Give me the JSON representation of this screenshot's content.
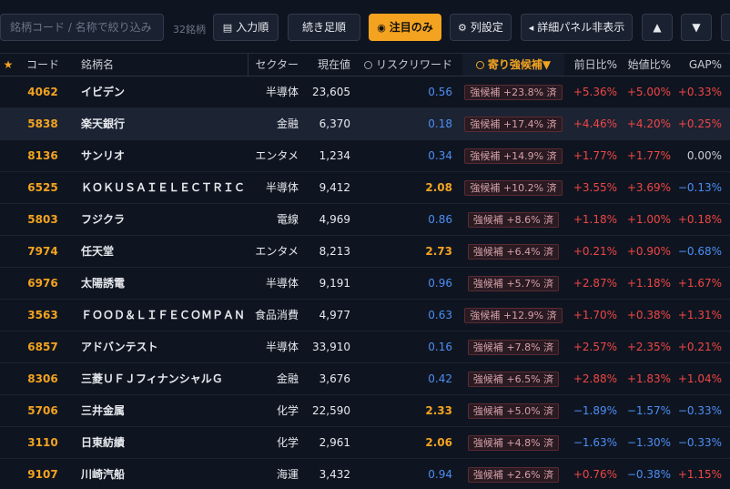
{
  "toolbar": {
    "search_placeholder": "銘柄コード / 名称で絞り込み",
    "count": "32銘柄",
    "btn_order": "入力順",
    "btn_daily": "続き足順",
    "btn_focus": "注目のみ",
    "btn_cols": "列設定",
    "btn_panel": "詳細パネル非表示",
    "btn_up": "▲",
    "btn_down": "▼"
  },
  "columns": {
    "star": "★",
    "code": "コード",
    "name": "銘柄名",
    "sector": "セクター",
    "price": "現在値",
    "rr": "リスクリワード",
    "strong": "寄り強候補▼",
    "prev": "前日比%",
    "open": "始値比%",
    "gap": "GAP%"
  },
  "rows": [
    {
      "code": "4062",
      "name": "イビデン",
      "sector": "半導体",
      "price": "23,605",
      "rr": "0.56",
      "rr_color": "blue",
      "strong": "強候補 +23.8% 済",
      "prev": "+5.36%",
      "prev_sign": "pos",
      "open": "+5.00%",
      "open_sign": "pos",
      "gap": "+0.33%",
      "gap_sign": "pos"
    },
    {
      "code": "5838",
      "name": "楽天銀行",
      "sector": "金融",
      "price": "6,370",
      "rr": "0.18",
      "rr_color": "blue",
      "strong": "強候補 +17.4% 済",
      "prev": "+4.46%",
      "prev_sign": "pos",
      "open": "+4.20%",
      "open_sign": "pos",
      "gap": "+0.25%",
      "gap_sign": "pos"
    },
    {
      "code": "8136",
      "name": "サンリオ",
      "sector": "エンタメ",
      "price": "1,234",
      "rr": "0.34",
      "rr_color": "blue",
      "strong": "強候補 +14.9% 済",
      "prev": "+1.77%",
      "prev_sign": "pos",
      "open": "+1.77%",
      "open_sign": "pos",
      "gap": "0.00%",
      "gap_sign": "zero"
    },
    {
      "code": "6525",
      "name": "ＫＯＫＵＳＡＩＥＬＥＣＴＲＩＣ",
      "sector": "半導体",
      "price": "9,412",
      "rr": "2.08",
      "rr_color": "orange",
      "strong": "強候補 +10.2% 済",
      "prev": "+3.55%",
      "prev_sign": "pos",
      "open": "+3.69%",
      "open_sign": "pos",
      "gap": "−0.13%",
      "gap_sign": "neg"
    },
    {
      "code": "5803",
      "name": "フジクラ",
      "sector": "電線",
      "price": "4,969",
      "rr": "0.86",
      "rr_color": "blue",
      "strong": "強候補 +8.6% 済",
      "prev": "+1.18%",
      "prev_sign": "pos",
      "open": "+1.00%",
      "open_sign": "pos",
      "gap": "+0.18%",
      "gap_sign": "pos"
    },
    {
      "code": "7974",
      "name": "任天堂",
      "sector": "エンタメ",
      "price": "8,213",
      "rr": "2.73",
      "rr_color": "orange",
      "strong": "強候補 +6.4% 済",
      "prev": "+0.21%",
      "prev_sign": "pos",
      "open": "+0.90%",
      "open_sign": "pos",
      "gap": "−0.68%",
      "gap_sign": "neg"
    },
    {
      "code": "6976",
      "name": "太陽誘電",
      "sector": "半導体",
      "price": "9,191",
      "rr": "0.96",
      "rr_color": "blue",
      "strong": "強候補 +5.7% 済",
      "prev": "+2.87%",
      "prev_sign": "pos",
      "open": "+1.18%",
      "open_sign": "pos",
      "gap": "+1.67%",
      "gap_sign": "pos"
    },
    {
      "code": "3563",
      "name": "ＦＯＯＤ＆ＬＩＦＥＣＯＭＰＡＮ",
      "sector": "食品消費",
      "price": "4,977",
      "rr": "0.63",
      "rr_color": "blue",
      "strong": "強候補 +12.9% 済",
      "prev": "+1.70%",
      "prev_sign": "pos",
      "open": "+0.38%",
      "open_sign": "pos",
      "gap": "+1.31%",
      "gap_sign": "pos"
    },
    {
      "code": "6857",
      "name": "アドバンテスト",
      "sector": "半導体",
      "price": "33,910",
      "rr": "0.16",
      "rr_color": "blue",
      "strong": "強候補 +7.8% 済",
      "prev": "+2.57%",
      "prev_sign": "pos",
      "open": "+2.35%",
      "open_sign": "pos",
      "gap": "+0.21%",
      "gap_sign": "pos"
    },
    {
      "code": "8306",
      "name": "三菱ＵＦＪフィナンシャルＧ",
      "sector": "金融",
      "price": "3,676",
      "rr": "0.42",
      "rr_color": "blue",
      "strong": "強候補 +6.5% 済",
      "prev": "+2.88%",
      "prev_sign": "pos",
      "open": "+1.83%",
      "open_sign": "pos",
      "gap": "+1.04%",
      "gap_sign": "pos"
    },
    {
      "code": "5706",
      "name": "三井金属",
      "sector": "化学",
      "price": "22,590",
      "rr": "2.33",
      "rr_color": "orange",
      "strong": "強候補 +5.0% 済",
      "prev": "−1.89%",
      "prev_sign": "neg",
      "open": "−1.57%",
      "open_sign": "neg",
      "gap": "−0.33%",
      "gap_sign": "neg"
    },
    {
      "code": "3110",
      "name": "日東紡績",
      "sector": "化学",
      "price": "2,961",
      "rr": "2.06",
      "rr_color": "orange",
      "strong": "強候補 +4.8% 済",
      "prev": "−1.63%",
      "prev_sign": "neg",
      "open": "−1.30%",
      "open_sign": "neg",
      "gap": "−0.33%",
      "gap_sign": "neg"
    },
    {
      "code": "9107",
      "name": "川崎汽船",
      "sector": "海運",
      "price": "3,432",
      "rr": "0.94",
      "rr_color": "blue",
      "strong": "強候補 +2.6% 済",
      "prev": "+0.76%",
      "prev_sign": "pos",
      "open": "−0.38%",
      "open_sign": "neg",
      "gap": "+1.15%",
      "gap_sign": "pos"
    }
  ],
  "colors": {
    "accent": "#f3a320",
    "positive": "#f04545",
    "negative": "#4c8df5",
    "background": "#0f1520"
  }
}
